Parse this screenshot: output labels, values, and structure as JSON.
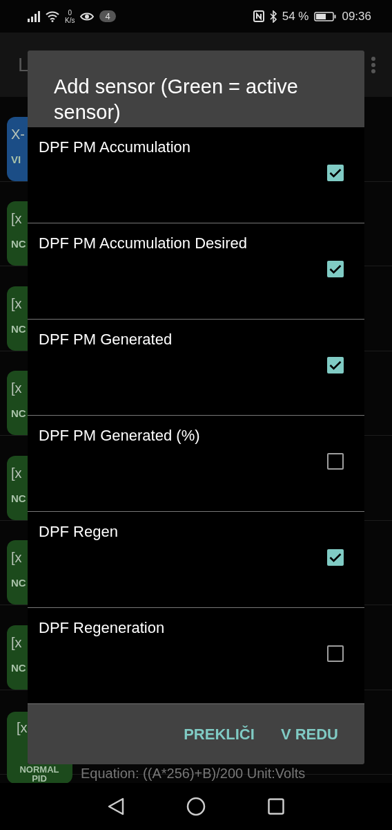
{
  "status_bar": {
    "speed_value": "0",
    "speed_unit": "K/s",
    "notification_count": "4",
    "battery": "54 %",
    "time": "09:36"
  },
  "app_bar": {
    "title": "L"
  },
  "background_list": [
    {
      "color": "#1b4d86",
      "line_1": "X-",
      "line_2": "VI"
    },
    {
      "color": "#1c4a1c",
      "line_1": "[x",
      "line_2": "NC"
    },
    {
      "color": "#1c4a1c",
      "line_1": "[x",
      "line_2": "NC"
    },
    {
      "color": "#1c4a1c",
      "line_1": "[x",
      "line_2": "NC"
    },
    {
      "color": "#1c4a1c",
      "line_1": "[x",
      "line_2": "NC"
    },
    {
      "color": "#1c4a1c",
      "line_1": "[x",
      "line_2": "NC"
    },
    {
      "color": "#1c4a1c",
      "line_1": "[x",
      "line_2": "NC"
    },
    {
      "color": "#1c4a1c",
      "line_1": "[x",
      "line_2": "NORMAL PID",
      "detail": "Equation: ((A*256)+B)/200  Unit:Volts"
    }
  ],
  "dialog": {
    "title": "Add sensor (Green  = active sensor)",
    "items": [
      {
        "label": "DPF PM Accumulation",
        "checked": true
      },
      {
        "label": "DPF PM Accumulation Desired",
        "checked": true
      },
      {
        "label": "DPF PM Generated",
        "checked": true
      },
      {
        "label": "DPF PM Generated (%)",
        "checked": false
      },
      {
        "label": "DPF Regen",
        "checked": true
      },
      {
        "label": "DPF Regeneration",
        "checked": false
      }
    ],
    "buttons": [
      "PREKLIČI",
      "V REDU"
    ]
  }
}
